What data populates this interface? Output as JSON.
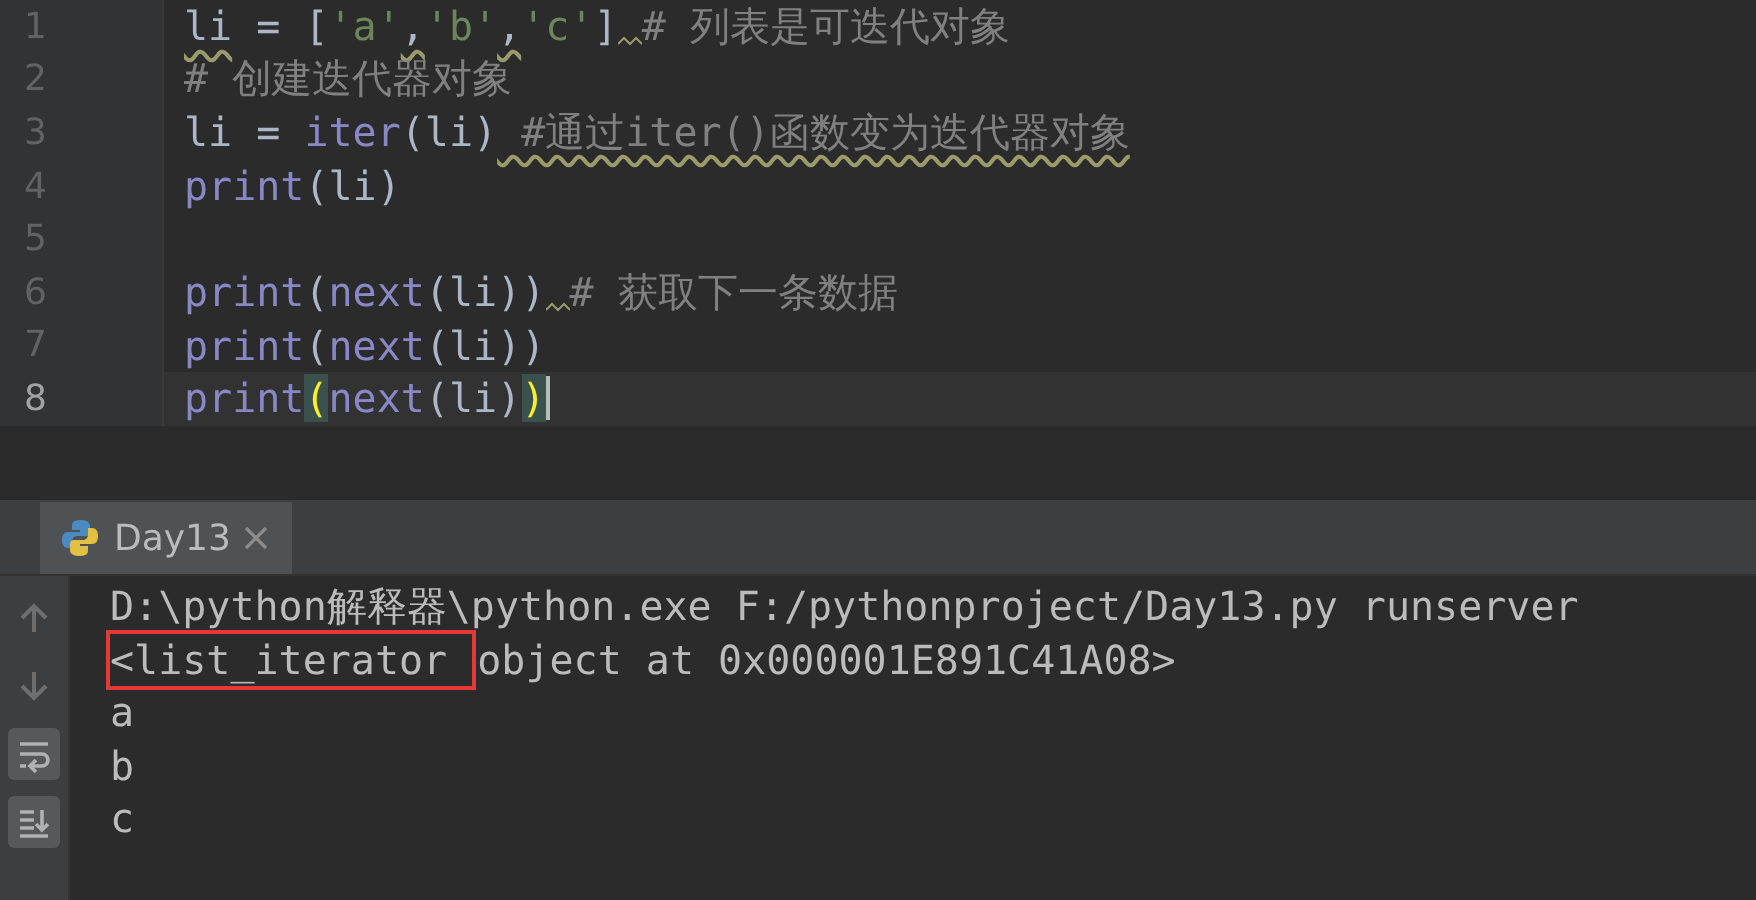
{
  "editor": {
    "lines": [
      {
        "number": "1",
        "current": false,
        "tokens": [
          {
            "text": "li",
            "kind": "plain",
            "warn": true
          },
          {
            "text": " = [",
            "kind": "plain",
            "warn": false
          },
          {
            "text": "'a'",
            "kind": "string",
            "warn": false
          },
          {
            "text": ",",
            "kind": "plain",
            "warn": true
          },
          {
            "text": "'b'",
            "kind": "string",
            "warn": false
          },
          {
            "text": ",",
            "kind": "plain",
            "warn": true
          },
          {
            "text": "'c'",
            "kind": "string",
            "warn": false
          },
          {
            "text": "]",
            "kind": "plain",
            "warn": false,
            "warn_after": true
          },
          {
            "text": "# 列表是可迭代对象",
            "kind": "comment",
            "warn": false
          }
        ]
      },
      {
        "number": "2",
        "current": false,
        "tokens": [
          {
            "text": "# 创建迭代器对象",
            "kind": "comment",
            "warn": false
          }
        ]
      },
      {
        "number": "3",
        "current": false,
        "tokens": [
          {
            "text": "li = ",
            "kind": "plain",
            "warn": false
          },
          {
            "text": "iter",
            "kind": "builtin",
            "warn": false
          },
          {
            "text": "(li)",
            "kind": "plain",
            "warn": false
          },
          {
            "text": " #通过iter()函数变为迭代器对象",
            "kind": "comment",
            "warn": true
          }
        ]
      },
      {
        "number": "4",
        "current": false,
        "tokens": [
          {
            "text": "print",
            "kind": "builtin",
            "warn": false
          },
          {
            "text": "(li)",
            "kind": "plain",
            "warn": false
          }
        ]
      },
      {
        "number": "5",
        "current": false
      },
      {
        "number": "6",
        "current": false,
        "tokens": [
          {
            "text": "print",
            "kind": "builtin",
            "warn": false
          },
          {
            "text": "(",
            "kind": "plain",
            "warn": false
          },
          {
            "text": "next",
            "kind": "builtin",
            "warn": false
          },
          {
            "text": "(li))",
            "kind": "plain",
            "warn": false,
            "warn_after": true
          },
          {
            "text": "# 获取下一条数据",
            "kind": "comment",
            "warn": false
          }
        ]
      },
      {
        "number": "7",
        "current": false,
        "tokens": [
          {
            "text": "print",
            "kind": "builtin",
            "warn": false
          },
          {
            "text": "(",
            "kind": "plain",
            "warn": false
          },
          {
            "text": "next",
            "kind": "builtin",
            "warn": false
          },
          {
            "text": "(li))",
            "kind": "plain",
            "warn": false
          }
        ]
      },
      {
        "number": "8",
        "current": true,
        "tokens": [
          {
            "text": "print",
            "kind": "builtin",
            "warn": false
          },
          {
            "text": "(",
            "kind": "match",
            "warn": false
          },
          {
            "text": "next",
            "kind": "builtin",
            "warn": false
          },
          {
            "text": "(li)",
            "kind": "plain",
            "warn": false
          },
          {
            "text": ")",
            "kind": "match",
            "warn": false
          }
        ]
      }
    ]
  },
  "run_panel": {
    "tabs": [
      {
        "label": "Day13",
        "selected": true
      }
    ],
    "toolbar": [
      {
        "kind": "up",
        "selected": false
      },
      {
        "kind": "down",
        "selected": false
      },
      {
        "kind": "wrap",
        "selected": true
      },
      {
        "kind": "scroll-end",
        "selected": true
      }
    ],
    "output": [
      [
        {
          "text": "D:\\python解释器\\python.exe F:/pythonproject/Day13.py runserver",
          "boxed": false
        }
      ],
      [
        {
          "text": "<list_iterator ",
          "boxed": true
        },
        {
          "text": "object at 0x000001E891C41A08>",
          "boxed": false
        }
      ],
      [
        {
          "text": "a",
          "boxed": false
        }
      ],
      [
        {
          "text": "b",
          "boxed": false
        }
      ],
      [
        {
          "text": "c",
          "boxed": false
        }
      ]
    ]
  }
}
